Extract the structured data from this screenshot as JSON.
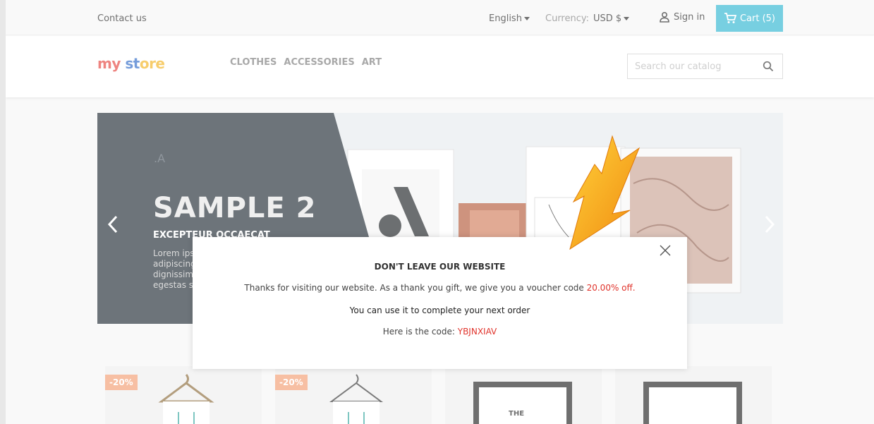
{
  "topbar": {
    "contact": "Contact us",
    "language": "English",
    "currency_label": "Currency:",
    "currency_value": "USD $",
    "signin": "Sign in",
    "cart": "Cart (5)"
  },
  "header": {
    "logo": {
      "part1": "my",
      "part2": " ",
      "part3": "st",
      "part4": "ore"
    },
    "nav": [
      "CLOTHES",
      "ACCESSORIES",
      "ART"
    ],
    "search_placeholder": "Search our catalog"
  },
  "slider": {
    "title": "SAMPLE 2",
    "subtitle": "EXCEPTEUR OCCAECAT",
    "text": [
      "Lorem ips",
      "adipiscing",
      "dignissim",
      "egestas s"
    ]
  },
  "products": [
    {
      "badge": "-20%"
    },
    {
      "badge": "-20%"
    },
    {
      "badge": ""
    },
    {
      "badge": ""
    }
  ],
  "modal": {
    "title": "DON'T LEAVE OUR WEBSITE",
    "line1_prefix": "Thanks for visiting our website. As a thank you gift, we give you a voucher code ",
    "line1_highlight": "20.00% off.",
    "line2": "You can use it to complete your next order",
    "line3_prefix": "Here is the code: ",
    "line3_code": "YBJNXIAV"
  },
  "colors": {
    "accent": "#2fb5d2",
    "highlight": "#e0332b",
    "badge": "#f39d72",
    "slide_dark": "#1f2a33"
  },
  "icons": [
    "user-icon",
    "cart-icon",
    "search-icon",
    "close-icon",
    "chevron-left-icon",
    "chevron-right-icon",
    "arrow-annotation-icon"
  ]
}
